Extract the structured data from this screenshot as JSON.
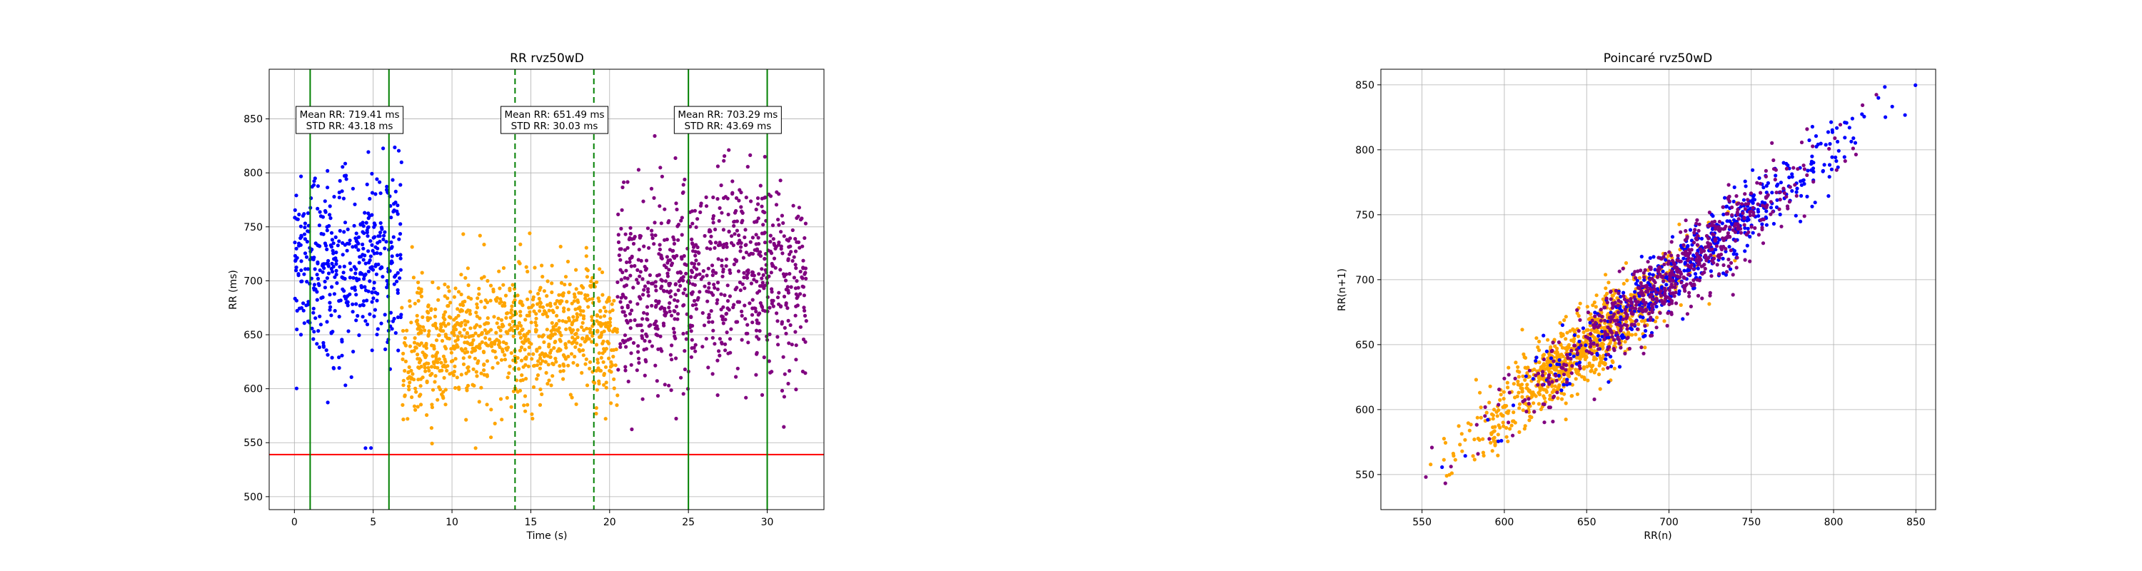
{
  "chart_data": [
    {
      "type": "scatter",
      "title": "RR rvz50wD",
      "xlabel": "Time (s)",
      "ylabel": "RR (ms)",
      "xlim": [
        -1.6,
        33.6
      ],
      "ylim": [
        488,
        896
      ],
      "xticks": [
        0,
        5,
        10,
        15,
        20,
        25,
        30
      ],
      "yticks": [
        500,
        550,
        600,
        650,
        700,
        750,
        800,
        850
      ],
      "grid": true,
      "series": [
        {
          "color": "#0000ff",
          "t_range": [
            0,
            6.8
          ],
          "mean": 719.41,
          "std": 43.18
        },
        {
          "color": "#ffa500",
          "t_range": [
            6.8,
            20.5
          ],
          "mean": 651.49,
          "std": 30.03
        },
        {
          "color": "#800080",
          "t_range": [
            20.5,
            32.5
          ],
          "mean": 703.29,
          "std": 43.69
        }
      ],
      "window_lines": [
        {
          "x": 1,
          "style": "solid",
          "color": "#008000"
        },
        {
          "x": 6,
          "style": "solid",
          "color": "#008000"
        },
        {
          "x": 14,
          "style": "dashed",
          "color": "#008000"
        },
        {
          "x": 19,
          "style": "dashed",
          "color": "#008000"
        },
        {
          "x": 25,
          "style": "solid",
          "color": "#008000"
        },
        {
          "x": 30,
          "style": "solid",
          "color": "#008000"
        }
      ],
      "threshold_line": {
        "y": 539,
        "color": "#ff0000"
      },
      "annotations": [
        {
          "x": 3.5,
          "y": 849,
          "line1": "Mean RR: 719.41 ms",
          "line2": "STD RR: 43.18 ms"
        },
        {
          "x": 16.5,
          "y": 849,
          "line1": "Mean RR: 651.49 ms",
          "line2": "STD RR: 30.03 ms"
        },
        {
          "x": 27.5,
          "y": 849,
          "line1": "Mean RR: 703.29 ms",
          "line2": "STD RR: 43.69 ms"
        }
      ]
    },
    {
      "type": "scatter",
      "title": "Poincaré rvz50wD",
      "xlabel": "RR(n)",
      "ylabel": "RR(n+1)",
      "xlim": [
        525,
        862
      ],
      "ylim": [
        523,
        862
      ],
      "xticks": [
        550,
        600,
        650,
        700,
        750,
        800,
        850
      ],
      "yticks": [
        550,
        600,
        650,
        700,
        750,
        800,
        850
      ],
      "grid": true,
      "series": [
        {
          "color": "#ffa500",
          "center": 648,
          "spread": 32
        },
        {
          "color": "#0000ff",
          "center": 716,
          "spread": 45
        },
        {
          "color": "#800080",
          "center": 700,
          "spread": 42
        }
      ]
    }
  ]
}
